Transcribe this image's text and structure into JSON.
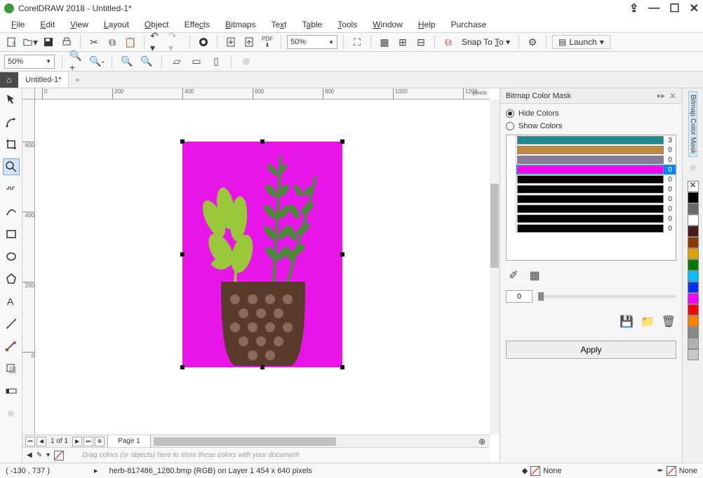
{
  "title": "CorelDRAW 2018 - Untitled-1*",
  "menus": [
    "File",
    "Edit",
    "View",
    "Layout",
    "Object",
    "Effects",
    "Bitmaps",
    "Text",
    "Table",
    "Tools",
    "Window",
    "Help",
    "Purchase"
  ],
  "zoom": "50%",
  "zoom2": "50%",
  "snap_label": "Snap To",
  "launch_label": "Launch",
  "tab_name": "Untitled-1*",
  "ruler_unit": "pixels",
  "page_nav": "1 of 1",
  "page_tab": "Page 1",
  "drop_hint": "Drag colors (or objects) here to store these colors with your document",
  "docker": {
    "title": "Bitmap Color Mask",
    "hide": "Hide Colors",
    "show": "Show Colors",
    "rows": [
      {
        "color": "#1b8a8f",
        "val": "3",
        "sel": false
      },
      {
        "color": "#c08a3a",
        "val": "0",
        "sel": false
      },
      {
        "color": "#8a7a9a",
        "val": "0",
        "sel": false
      },
      {
        "color": "#ff00ff",
        "val": "0",
        "sel": true
      },
      {
        "color": "#000000",
        "val": "0",
        "sel": false
      },
      {
        "color": "#000000",
        "val": "0",
        "sel": false
      },
      {
        "color": "#000000",
        "val": "0",
        "sel": false
      },
      {
        "color": "#000000",
        "val": "0",
        "sel": false
      },
      {
        "color": "#000000",
        "val": "0",
        "sel": false
      },
      {
        "color": "#000000",
        "val": "0",
        "sel": false
      }
    ],
    "tolerance": "0",
    "apply": "Apply"
  },
  "dock_label": "Bitmap Color Mask",
  "palette": [
    "#000000",
    "#6a6a6a",
    "#ffffff",
    "#4a1a1a",
    "#8a3a00",
    "#e0a000",
    "#007a00",
    "#00bfff",
    "#0030ff",
    "#ff00ff",
    "#ff0000",
    "#ff8000",
    "#888888",
    "#b0b0b0",
    "#c8c8c8"
  ],
  "status": {
    "coords": "( -130 , 737  )",
    "info": "herb-817486_1280.bmp (RGB) on Layer 1 454 x 640 pixels",
    "none": "None"
  },
  "ruler_h": [
    {
      "p": 10,
      "l": "0"
    },
    {
      "p": 110,
      "l": "200"
    },
    {
      "p": 210,
      "l": "400"
    },
    {
      "p": 310,
      "l": "600"
    },
    {
      "p": 410,
      "l": "800"
    }
  ],
  "ruler_h2": [
    {
      "p": 10,
      "l": "0"
    },
    {
      "p": 110,
      "l": "200"
    },
    {
      "p": 210,
      "l": "400"
    },
    {
      "p": 310,
      "l": "600"
    },
    {
      "p": 410,
      "l": "800"
    }
  ],
  "ruler_v": [
    {
      "p": 60,
      "l": "600"
    },
    {
      "p": 160,
      "l": "400"
    },
    {
      "p": 260,
      "l": "200"
    },
    {
      "p": 360,
      "l": "0"
    }
  ]
}
